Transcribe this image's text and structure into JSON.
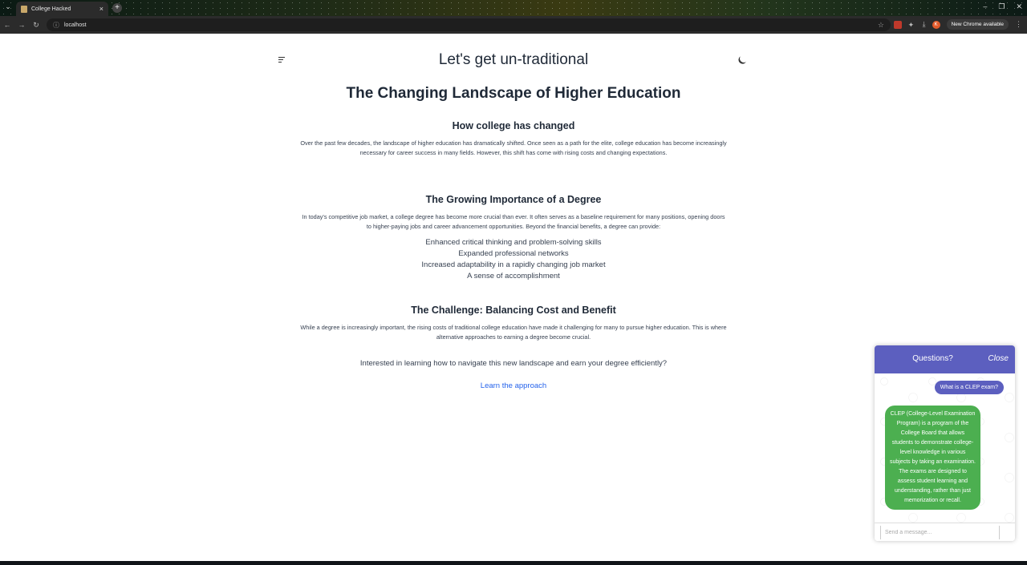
{
  "browser": {
    "tab_title": "College Hacked",
    "url": "localhost",
    "update_label": "New Chrome available"
  },
  "header": {
    "site_title": "Let's get un-traditional"
  },
  "main": {
    "heading": "The Changing Landscape of Higher Education",
    "sections": [
      {
        "title": "How college has changed",
        "lines": [
          "Over the past few decades, the landscape of higher education has dramatically shifted. Once seen as a path for the elite, college education has become increasingly",
          "necessary for career success in many fields. However, this shift has come with rising costs and changing expectations."
        ]
      },
      {
        "title": "The Growing Importance of a Degree",
        "lines": [
          "In today's competitive job market, a college degree has become more crucial than ever. It often serves as a baseline requirement for many positions, opening doors",
          "to higher-paying jobs and career advancement opportunities. Beyond the financial benefits, a degree can provide:"
        ],
        "bullets": [
          "Enhanced critical thinking and problem-solving skills",
          "Expanded professional networks",
          "Increased adaptability in a rapidly changing job market",
          "A sense of accomplishment"
        ]
      },
      {
        "title": "The Challenge: Balancing Cost and Benefit",
        "lines": [
          "While a degree is increasingly important, the rising costs of traditional college education have made it challenging for many to pursue higher education. This is where",
          "alternative approaches to earning a degree become crucial."
        ]
      }
    ],
    "cta_text": "Interested in learning how to navigate this new landscape and earn your degree efficiently?",
    "cta_link": "Learn the approach"
  },
  "chat": {
    "title": "Questions?",
    "close_label": "Close",
    "user_message": "What is a CLEP exam?",
    "bot_message": "CLEP (College-Level Examination Program) is a program of the College Board that allows students to demonstrate college-level knowledge in various subjects by taking an examination. The exams are designed to assess student learning and understanding, rather than just memorization or recall.",
    "input_placeholder": "Send a message...",
    "colors": {
      "header": "#5c5fbf",
      "bot_bubble": "#4caf50"
    }
  },
  "icons": {
    "menu": "menu-icon",
    "theme": "moon-icon"
  }
}
